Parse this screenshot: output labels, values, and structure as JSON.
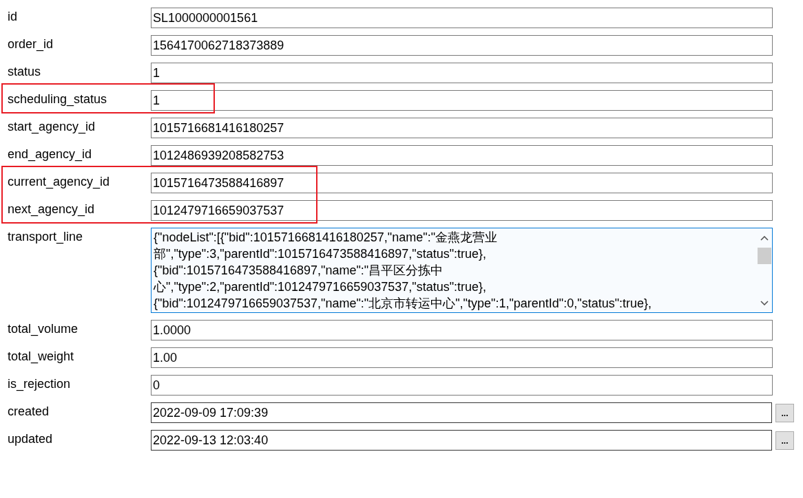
{
  "fields": [
    {
      "label": "id",
      "kind": "text",
      "value": "SL1000000001561",
      "highlighted": false
    },
    {
      "label": "order_id",
      "kind": "text",
      "value": "1564170062718373889",
      "highlighted": false
    },
    {
      "label": "status",
      "kind": "text",
      "value": "1",
      "highlighted": false
    },
    {
      "label": "scheduling_status",
      "kind": "text",
      "value": "1",
      "highlighted": true
    },
    {
      "label": "start_agency_id",
      "kind": "text",
      "value": "1015716681416180257",
      "highlighted": false
    },
    {
      "label": "end_agency_id",
      "kind": "text",
      "value": "1012486939208582753",
      "highlighted": false
    },
    {
      "label": "current_agency_id",
      "kind": "text",
      "value": "1015716473588416897",
      "highlighted": true
    },
    {
      "label": "next_agency_id",
      "kind": "text",
      "value": "1012479716659037537",
      "highlighted": true
    },
    {
      "label": "transport_line",
      "kind": "memo",
      "value_lines": [
        "{\"nodeList\":[{\"bid\":1015716681416180257,\"name\":\"金燕龙营业",
        "部\",\"type\":3,\"parentId\":1015716473588416897,\"status\":true},",
        "{\"bid\":1015716473588416897,\"name\":\"昌平区分拣中",
        "心\",\"type\":2,\"parentId\":1012479716659037537,\"status\":true},",
        "{\"bid\":1012479716659037537,\"name\":\"北京市转运中心\",\"type\":1,\"parentId\":0,\"status\":true},"
      ],
      "highlighted": false
    },
    {
      "label": "total_volume",
      "kind": "text",
      "value": "1.0000",
      "highlighted": false
    },
    {
      "label": "total_weight",
      "kind": "text",
      "value": "1.00",
      "highlighted": false
    },
    {
      "label": "is_rejection",
      "kind": "text",
      "value": "0",
      "highlighted": false
    },
    {
      "label": "created",
      "kind": "datetime",
      "value": "2022-09-09 17:09:39",
      "button": "...",
      "highlighted": false
    },
    {
      "label": "updated",
      "kind": "datetime",
      "value": "2022-09-13 12:03:40",
      "button": "...",
      "highlighted": false
    }
  ]
}
